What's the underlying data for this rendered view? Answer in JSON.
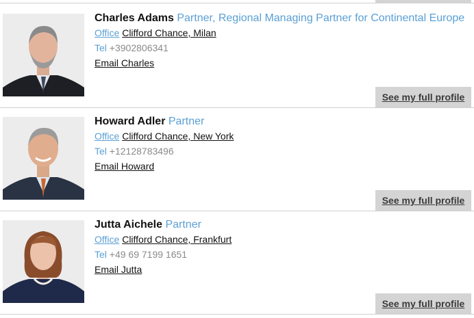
{
  "people": [
    {
      "name": "Charles Adams",
      "title": "Partner, Regional Managing Partner for Continental Europe",
      "office_label": "Office",
      "office": "Clifford Chance, Milan",
      "tel_label": "Tel",
      "tel": "+3902806341",
      "email_label": "Email Charles",
      "profile_label": "See my full profile"
    },
    {
      "name": "Howard Adler",
      "title": "Partner",
      "office_label": "Office",
      "office": "Clifford Chance, New York",
      "tel_label": "Tel",
      "tel": "+12128783496",
      "email_label": "Email Howard",
      "profile_label": "See my full profile"
    },
    {
      "name": "Jutta Aichele",
      "title": "Partner",
      "office_label": "Office",
      "office": "Clifford Chance, Frankfurt",
      "tel_label": "Tel",
      "tel": "+49 69 7199 1651",
      "email_label": "Email Jutta",
      "profile_label": "See my full profile"
    }
  ]
}
